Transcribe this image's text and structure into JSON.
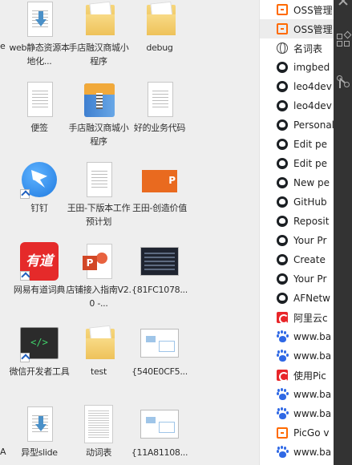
{
  "desktop": {
    "edge_labels": [
      "e",
      "A"
    ],
    "icons": [
      {
        "label": "web静态资源本地化...",
        "type": "doc-blue",
        "shortcut": false
      },
      {
        "label": "手店融汉商城小程序",
        "type": "folder",
        "shortcut": false
      },
      {
        "label": "debug",
        "type": "folder",
        "shortcut": false
      },
      {
        "label": "便签",
        "type": "doc",
        "shortcut": false
      },
      {
        "label": "手店融汉商城小程序",
        "type": "archive",
        "shortcut": false
      },
      {
        "label": "好的业务代码",
        "type": "doc",
        "shortcut": false
      },
      {
        "label": "钉钉",
        "type": "dingtalk",
        "shortcut": true
      },
      {
        "label": "王田-下版本工作预计划",
        "type": "doc",
        "shortcut": false
      },
      {
        "label": "王田-创造价值",
        "type": "ppt-red",
        "shortcut": false
      },
      {
        "label": "网易有道词典",
        "type": "youdao",
        "shortcut": true
      },
      {
        "label": "店铺接入指南V2.0 -...",
        "type": "ppt-doc",
        "shortcut": false
      },
      {
        "label": "{81FC1078...",
        "type": "thumb-dark",
        "shortcut": false
      },
      {
        "label": "微信开发者工具",
        "type": "devtools",
        "shortcut": true
      },
      {
        "label": "test",
        "type": "folder",
        "shortcut": false
      },
      {
        "label": "{540E0CF5...",
        "type": "thumb-light",
        "shortcut": false
      },
      {
        "label": "异型slide",
        "type": "doc-blue",
        "shortcut": false
      },
      {
        "label": "动词表",
        "type": "thumb-page",
        "shortcut": false
      },
      {
        "label": "{11A81108...",
        "type": "thumb-light",
        "shortcut": false
      }
    ],
    "youdao_text": "有道"
  },
  "tabs": [
    {
      "label": "OSS管理",
      "icon": "oss-icon",
      "active": false
    },
    {
      "label": "OSS管理",
      "icon": "oss-icon",
      "active": true
    },
    {
      "label": "名词表",
      "icon": "globe-icon",
      "active": false
    },
    {
      "label": "imgbed",
      "icon": "github-icon",
      "active": false
    },
    {
      "label": "leo4dev",
      "icon": "github-icon",
      "active": false
    },
    {
      "label": "leo4dev",
      "icon": "github-icon",
      "active": false
    },
    {
      "label": "Personal",
      "icon": "github-icon",
      "active": false
    },
    {
      "label": "Edit pe",
      "icon": "github-icon",
      "active": false
    },
    {
      "label": "Edit pe",
      "icon": "github-icon",
      "active": false
    },
    {
      "label": "New pe",
      "icon": "github-icon",
      "active": false
    },
    {
      "label": "GitHub",
      "icon": "github-icon",
      "active": false
    },
    {
      "label": "Reposit",
      "icon": "github-icon",
      "active": false
    },
    {
      "label": "Your Pr",
      "icon": "github-icon",
      "active": false
    },
    {
      "label": "Create",
      "icon": "github-icon",
      "active": false
    },
    {
      "label": "Your Pr",
      "icon": "github-icon",
      "active": false
    },
    {
      "label": "AFNetw",
      "icon": "github-icon",
      "active": false
    },
    {
      "label": "阿里云c",
      "icon": "aliyun-icon",
      "active": false
    },
    {
      "label": "www.ba",
      "icon": "baidu-icon",
      "active": false
    },
    {
      "label": "www.ba",
      "icon": "baidu-icon",
      "active": false
    },
    {
      "label": "使用Pic",
      "icon": "aliyun-icon",
      "active": false
    },
    {
      "label": "www.ba",
      "icon": "baidu-icon",
      "active": false
    },
    {
      "label": "www.ba",
      "icon": "baidu-icon",
      "active": false
    },
    {
      "label": "PicGo v",
      "icon": "oss-icon",
      "active": false
    },
    {
      "label": "www.ba",
      "icon": "baidu-icon",
      "active": false
    }
  ]
}
